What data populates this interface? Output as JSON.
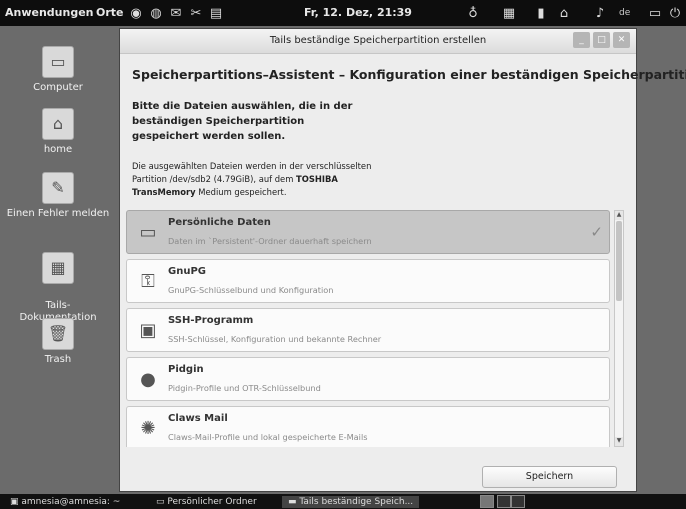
{
  "top_panel": {
    "applications": "Anwendungen",
    "places": "Orte",
    "clock": "Fr, 12. Dez, 21:39",
    "language": "de",
    "launcher_icons": [
      "browser-icon",
      "network-icon",
      "mail-icon",
      "tools-icon",
      "terminal-icon"
    ],
    "tray_icons": [
      "tor-onion-icon",
      "keyboard-icon",
      "clipboard-icon",
      "usb-icon",
      "volume-icon"
    ]
  },
  "desktop": {
    "icons": [
      {
        "label": "Computer"
      },
      {
        "label": "home"
      },
      {
        "label": "Einen Fehler melden"
      },
      {
        "label": "Tails-\nDokumentation"
      },
      {
        "label": "Trash"
      }
    ]
  },
  "dialog": {
    "title": "Tails beständige Speicherpartition erstellen",
    "heading": "Speicherpartitions–Assistent – Konfiguration einer beständigen Speicherpartition",
    "instruction": "Bitte die Dateien auswählen, die in der beständigen Speicherpartition gespeichert werden sollen.",
    "info_prefix": "Die ausgewählten Dateien werden in der verschlüsselten Partition /dev/sdb2 (4.79GiB), auf dem ",
    "info_device": "TOSHIBA TransMemory",
    "info_suffix": " Medium gespeichert.",
    "items": [
      {
        "name": "Persönliche Daten",
        "desc": "Daten im `Persistent'-Ordner dauerhaft speichern",
        "icon": "folder-icon",
        "selected": true
      },
      {
        "name": "GnuPG",
        "desc": "GnuPG-Schlüsselbund und Konfiguration",
        "icon": "key-icon",
        "selected": false
      },
      {
        "name": "SSH-Programm",
        "desc": "SSH-Schlüssel, Konfiguration und bekannte Rechner",
        "icon": "terminal-key-icon",
        "selected": false
      },
      {
        "name": "Pidgin",
        "desc": "Pidgin-Profile und OTR-Schlüsselbund",
        "icon": "pidgin-icon",
        "selected": false
      },
      {
        "name": "Claws Mail",
        "desc": "Claws-Mail-Profile und lokal gespeicherte E-Mails",
        "icon": "claws-mail-icon",
        "selected": false
      }
    ],
    "save_label": "Speichern"
  },
  "taskbar": {
    "tasks": [
      {
        "label": "amnesia@amnesia: ~"
      },
      {
        "label": "Persönlicher Ordner"
      },
      {
        "label": "Tails beständige Speich..."
      }
    ]
  }
}
